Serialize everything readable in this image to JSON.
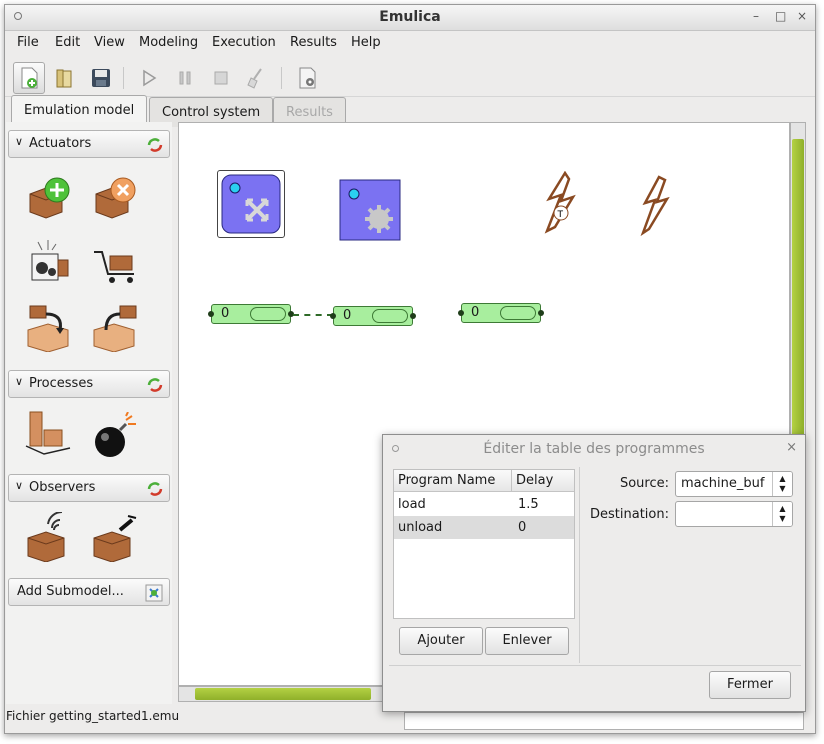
{
  "window": {
    "title": "Emulica",
    "controls": [
      "–",
      "□",
      "×"
    ]
  },
  "menu": [
    "File",
    "Edit",
    "View",
    "Modeling",
    "Execution",
    "Results",
    "Help"
  ],
  "toolbar": {
    "icons": [
      "new-icon",
      "open-icon",
      "save-icon",
      "play-icon",
      "pause-icon",
      "stop-icon",
      "clean-icon",
      "properties-icon"
    ]
  },
  "tabs": [
    {
      "label": "Emulation model",
      "state": "active"
    },
    {
      "label": "Control system",
      "state": "normal"
    },
    {
      "label": "Results",
      "state": "disabled"
    }
  ],
  "palette": {
    "actuators": {
      "label": "Actuators",
      "items": [
        "create-actuator-icon",
        "destroy-actuator-icon",
        "space-actuator-icon",
        "shape-actuator-icon",
        "assemble-actuator-icon",
        "disassemble-actuator-icon"
      ]
    },
    "processes": {
      "label": "Processes",
      "items": [
        "holder-process-icon",
        "failure-process-icon"
      ]
    },
    "observers": {
      "label": "Observers",
      "items": [
        "push-observer-icon",
        "pull-observer-icon"
      ]
    },
    "add_submodel": "Add Submodel..."
  },
  "canvas": {
    "buffers": [
      {
        "count": "0"
      },
      {
        "count": "0"
      },
      {
        "count": "0"
      }
    ]
  },
  "status": {
    "text": "Fichier getting_started1.emu"
  },
  "dialog": {
    "title": "Éditer la table des programmes",
    "close": "×",
    "columns": [
      "Program Name",
      "Delay"
    ],
    "rows": [
      {
        "name": "load",
        "delay": "1.5"
      },
      {
        "name": "unload",
        "delay": "0"
      }
    ],
    "add_button": "Ajouter",
    "remove_button": "Enlever",
    "source_label": "Source:",
    "source_value": "machine_buf",
    "destination_label": "Destination:",
    "destination_value": "",
    "close_button": "Fermer"
  },
  "colors": {
    "accent_green": "#a0c83a",
    "machine_blue": "#7b72f2",
    "buffer_green": "#a8ee9e",
    "failure_brown": "#8a4a22"
  }
}
